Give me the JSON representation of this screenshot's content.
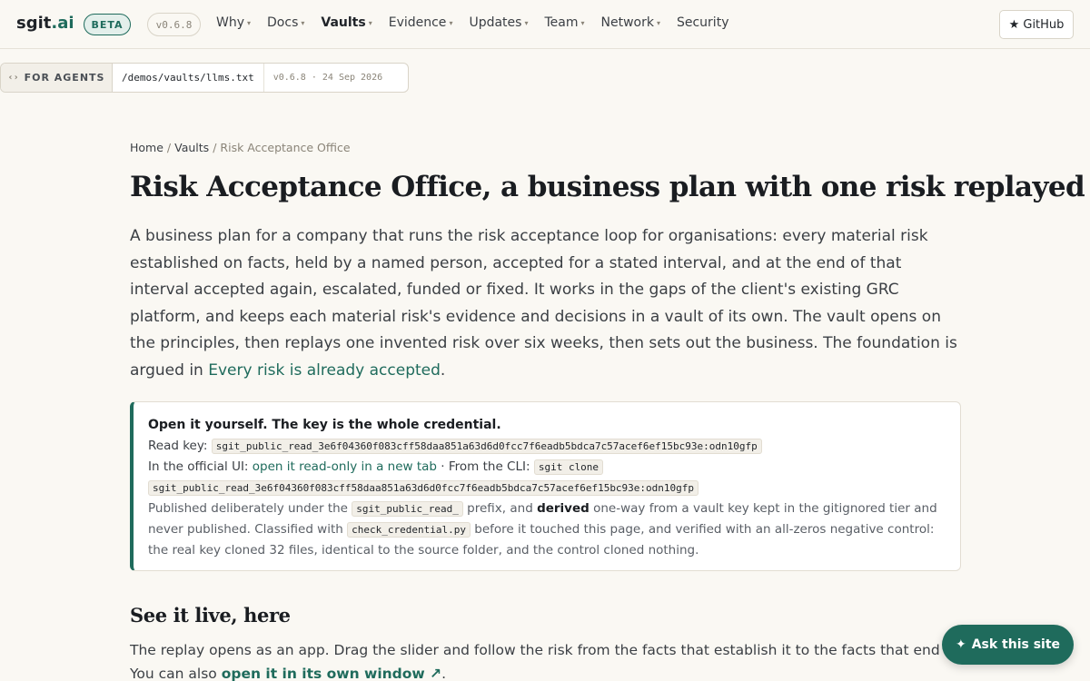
{
  "brand": {
    "name": "sgit",
    "tld": ".ai",
    "badge": "BETA",
    "version": "v0.6.8"
  },
  "nav": {
    "items": [
      {
        "label": "Why",
        "caret": true,
        "active": false
      },
      {
        "label": "Docs",
        "caret": true,
        "active": false
      },
      {
        "label": "Vaults",
        "caret": true,
        "active": true
      },
      {
        "label": "Evidence",
        "caret": true,
        "active": false
      },
      {
        "label": "Updates",
        "caret": true,
        "active": false
      },
      {
        "label": "Team",
        "caret": true,
        "active": false
      },
      {
        "label": "Network",
        "caret": true,
        "active": false
      },
      {
        "label": "Security",
        "caret": false,
        "active": false
      }
    ],
    "caret_glyph": "▾",
    "github_label": "★ GitHub"
  },
  "agents": {
    "icon": "‹›",
    "label": "FOR AGENTS",
    "path": "/demos/vaults/llms.txt",
    "meta": "v0.6.8 · 24 Sep 2026"
  },
  "breadcrumb": {
    "home": "Home",
    "vaults": "Vaults",
    "current": "Risk Acceptance Office",
    "sep": "/"
  },
  "page_title": "Risk Acceptance Office, a business plan with one risk replayed",
  "lede": {
    "text": "A business plan for a company that runs the risk acceptance loop for organisations: every material risk established on facts, held by a named person, accepted for a stated interval, and at the end of that interval accepted again, escalated, funded or fixed. It works in the gaps of the client's existing GRC platform, and keeps each material risk's evidence and decisions in a vault of its own. The vault opens on the principles, then replays one invented risk over six weeks, then sets out the business. The foundation is argued in ",
    "link": "Every risk is already accepted",
    "end": "."
  },
  "keybox": {
    "heading": "Open it yourself. The key is the whole credential.",
    "read_key_label": "Read key:",
    "read_key": "sgit_public_read_3e6f04360f083cff58daa851a63d6d0fcc7f6eadb5bdca7c57acef6ef15bc93e:odn10gfp",
    "ui_label": "In the official UI:",
    "ui_link": "open it read-only in a new tab",
    "cli_label": "· From the CLI:",
    "cli_cmd_1": "sgit clone",
    "cli_cmd_2": "sgit_public_read_3e6f04360f083cff58daa851a63d6d0fcc7f6eadb5bdca7c57acef6ef15bc93e:odn10gfp",
    "note_1": "Published deliberately under the",
    "prefix": "sgit_public_read_",
    "note_2": "prefix, and",
    "derived": "derived",
    "note_3": "one-way from a vault key kept in the gitignored tier and never published. Classified with",
    "script": "check_credential.py",
    "note_4": "before it touched this page, and verified with an all-zeros negative control: the real key cloned 32 files, identical to the source folder, and the control cloned nothing."
  },
  "live": {
    "heading": "See it live, here",
    "text": "The replay opens as an app. Drag the slider and follow the risk from the facts that establish it to the facts that end it. You can also ",
    "link": "open it in its own window ↗",
    "end": "."
  },
  "ask": {
    "icon": "✦",
    "label": "Ask this site"
  },
  "colors": {
    "accent": "#1f6b5c",
    "background": "#faf8f3"
  }
}
